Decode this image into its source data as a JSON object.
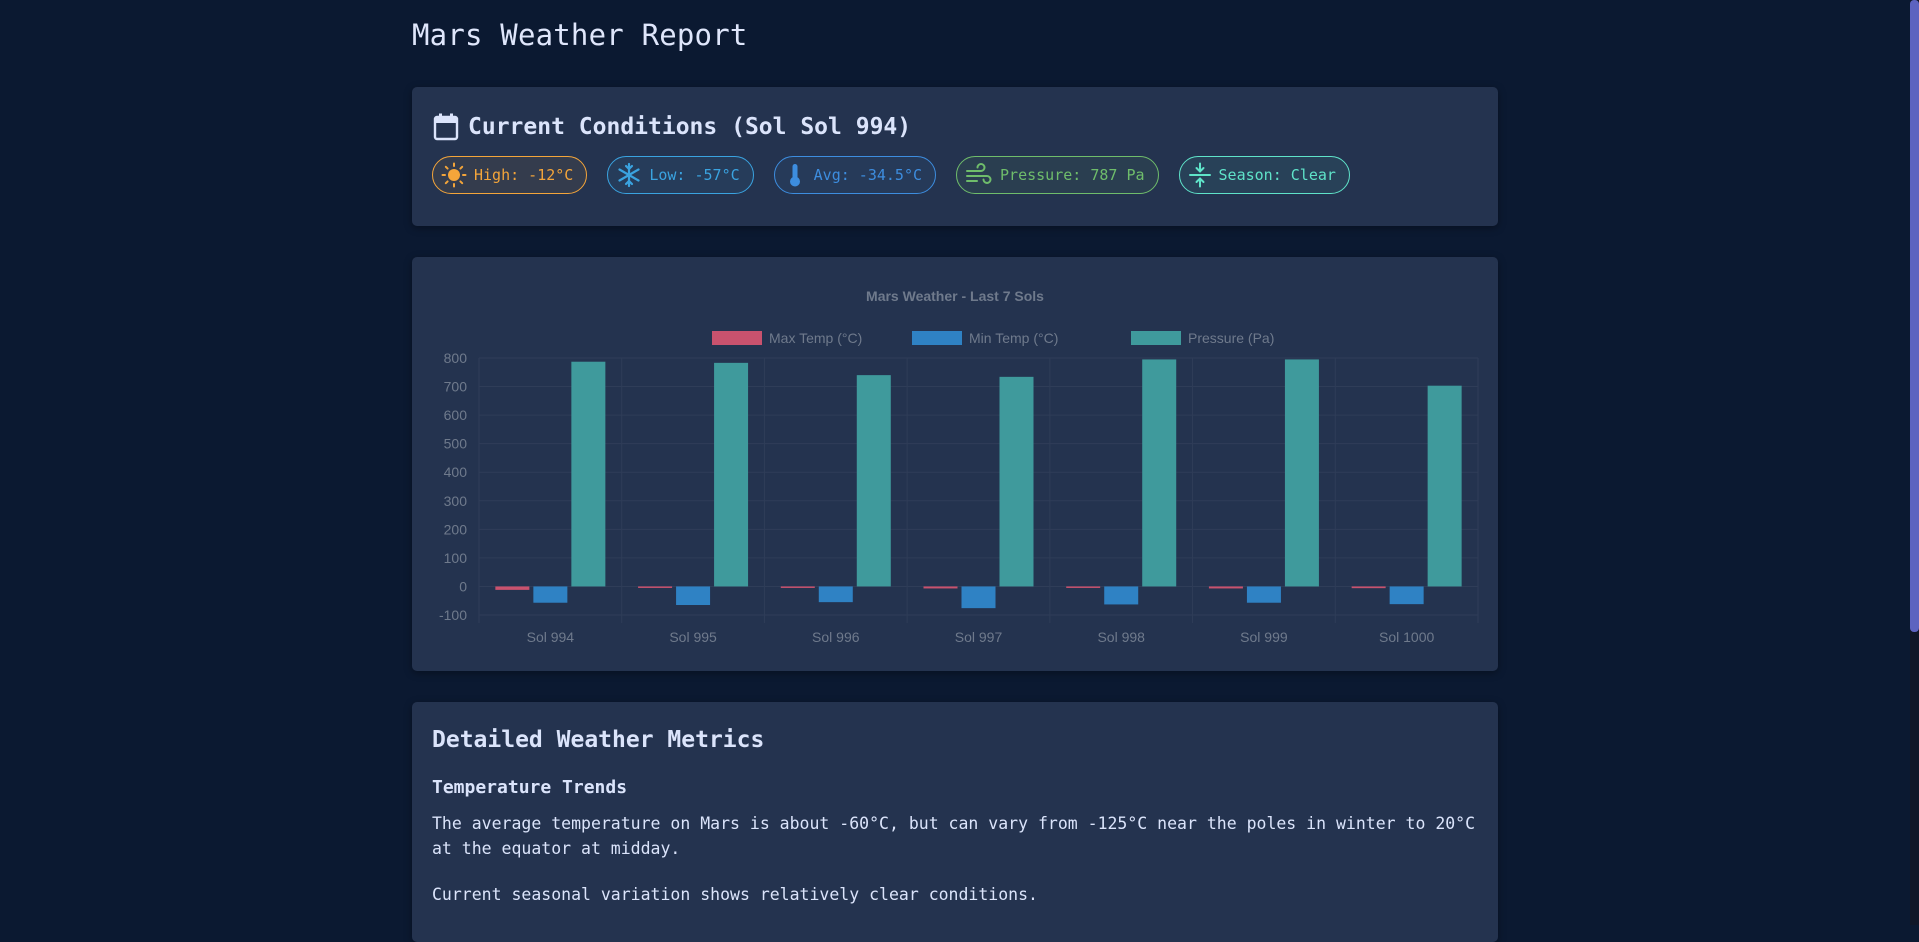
{
  "page": {
    "title": "Mars Weather Report"
  },
  "current": {
    "title": "Current Conditions (Sol Sol 994)",
    "badges": {
      "high": "High: -12°C",
      "low": "Low: -57°C",
      "avg": "Avg: -34.5°C",
      "pressure": "Pressure: 787 Pa",
      "season": "Season: Clear"
    },
    "colors": {
      "high": "#f4a53a",
      "low": "#3aa3e0",
      "avg": "#3d8ddf",
      "pressure": "#6fbd6b",
      "season": "#5fe3c9"
    },
    "icons": {
      "high": "sun-icon",
      "low": "snowflake-icon",
      "avg": "thermometer-icon",
      "pressure": "wind-icon",
      "season": "compress-icon",
      "title": "calendar-icon"
    }
  },
  "chart_data": {
    "type": "bar",
    "title": "Mars Weather - Last 7 Sols",
    "categories": [
      "Sol 994",
      "Sol 995",
      "Sol 996",
      "Sol 997",
      "Sol 998",
      "Sol 999",
      "Sol 1000"
    ],
    "series": [
      {
        "name": "Max Temp (°C)",
        "color": "#c9526e",
        "values": [
          -12,
          -5,
          -1,
          -7,
          -3,
          -7,
          -6
        ]
      },
      {
        "name": "Min Temp (°C)",
        "color": "#2f82c4",
        "values": [
          -57,
          -65,
          -55,
          -76,
          -63,
          -57,
          -62
        ]
      },
      {
        "name": "Pressure (Pa)",
        "color": "#3f9a9c",
        "values": [
          787,
          783,
          740,
          734,
          795,
          795,
          703
        ]
      }
    ],
    "ylim": [
      -100,
      800
    ],
    "yticks": [
      -100,
      0,
      100,
      200,
      300,
      400,
      500,
      600,
      700,
      800
    ],
    "legend_position": "top",
    "grid": true
  },
  "details": {
    "title": "Detailed Weather Metrics",
    "subtitle": "Temperature Trends",
    "paragraph1": "The average temperature on Mars is about -60°C, but can vary from -125°C near the poles in winter to 20°C at the equator at midday.",
    "paragraph2": "Current seasonal variation shows relatively clear conditions."
  }
}
